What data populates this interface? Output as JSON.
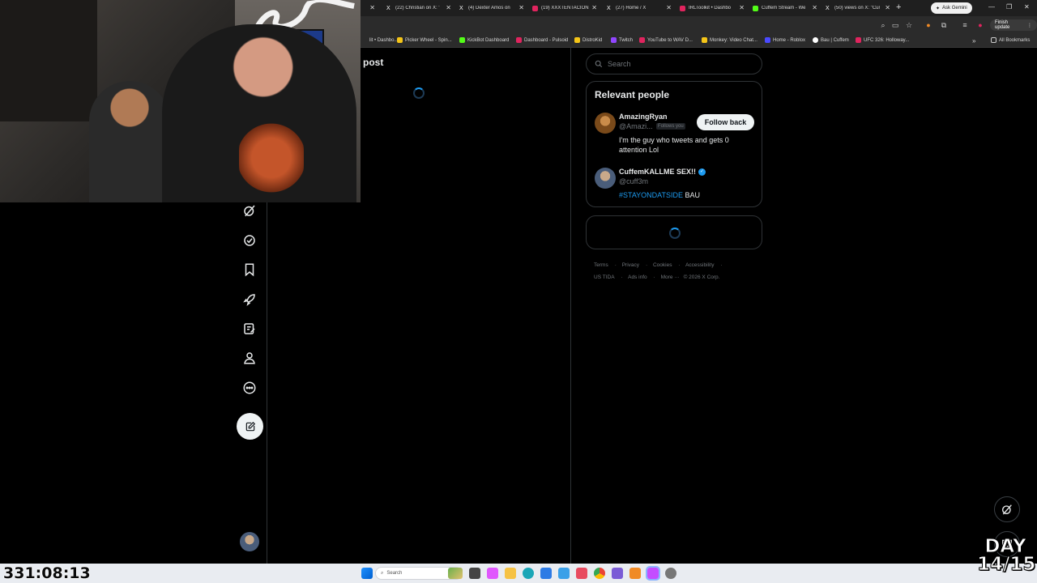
{
  "browser": {
    "tabs": [
      {
        "label": "",
        "favicon_color": "#1da1f2"
      },
      {
        "label": "(22) Christian on X: '",
        "favicon_color": "#ffffff"
      },
      {
        "label": "(4) Dexter Amos on",
        "favicon_color": "#ffffff"
      },
      {
        "label": "(19) XXXTENTACION",
        "favicon_color": "#e0245e"
      },
      {
        "label": "(27) Home / X",
        "favicon_color": "#ffffff"
      },
      {
        "label": "IRLToolkit • Dashbo",
        "favicon_color": "#e0245e"
      },
      {
        "label": "Cuffem Stream - We",
        "favicon_color": "#53fc18"
      },
      {
        "label": "(50) views on X: \"Cur",
        "favicon_color": "#ffffff"
      }
    ],
    "ask_gemini": "Ask Gemini",
    "finish_update": "Finish update",
    "bookmarks": [
      {
        "label": "lit • Dashbo...",
        "color": "#e0245e"
      },
      {
        "label": "Picker Wheel - Spin...",
        "color": "#f5c518"
      },
      {
        "label": "KickBot Dashboard",
        "color": "#53fc18"
      },
      {
        "label": "Dashboard - Pulsoid",
        "color": "#e0245e"
      },
      {
        "label": "DistroKid",
        "color": "#f5c518"
      },
      {
        "label": "Twitch",
        "color": "#9146ff"
      },
      {
        "label": "YouTube to WAV D...",
        "color": "#e0245e"
      },
      {
        "label": "Monkey: Video Chat...",
        "color": "#f5c518"
      },
      {
        "label": "Home - Roblox",
        "color": "#4a4aff"
      },
      {
        "label": "Bau | Cuffem",
        "color": "#ffffff"
      },
      {
        "label": "UFC 326: Holloway...",
        "color": "#e0245e"
      }
    ],
    "all_bookmarks": "All Bookmarks"
  },
  "main": {
    "title": "post"
  },
  "right": {
    "search_placeholder": "Search",
    "relevant_title": "Relevant people",
    "people": [
      {
        "name": "AmazingRyan",
        "handle": "@Amazi...",
        "follows_you": "Follows you",
        "bio": "I'm the guy who tweets and gets 0 attention Lol",
        "button": "Follow back",
        "verified": false
      },
      {
        "name": "CuffemKALLME SEX!!",
        "handle": "@cuff3m",
        "bio_hashtag": "#STAYONDATSIDE",
        "bio_rest": " BAU",
        "verified": true
      }
    ],
    "footer": {
      "terms": "Terms",
      "privacy": "Privacy",
      "cookies": "Cookies",
      "accessibility": "Accessibility",
      "ads_info": "Ads info",
      "more": "More ···",
      "copyright": "© 2026 X Corp.",
      "us_tida": "US TIDA"
    }
  },
  "taskbar": {
    "search": "Search"
  },
  "overlay": {
    "timer": "331:08:13",
    "day_label": "DAY",
    "day_count": "14/15"
  },
  "colors": {
    "accent": "#1d9bf0",
    "background": "#000000",
    "border": "#2f3336"
  }
}
